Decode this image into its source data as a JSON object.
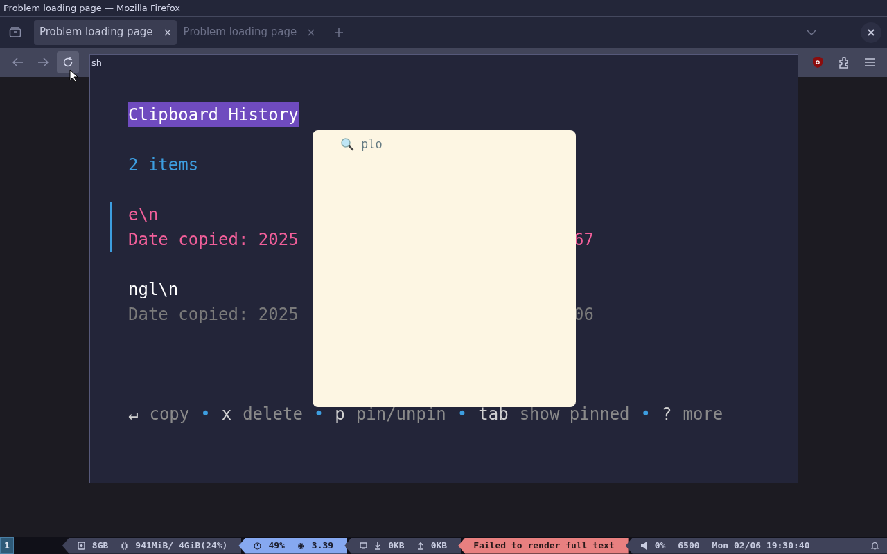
{
  "window": {
    "title": "Problem loading page — Mozilla Firefox"
  },
  "tabs": [
    {
      "label": "Problem loading page",
      "selected": true
    },
    {
      "label": "Problem loading page",
      "selected": false
    }
  ],
  "terminal": {
    "title": "sh",
    "heading": "Clipboard History",
    "count": "2 items",
    "entries": [
      {
        "text": "e\\n",
        "date_start": "Date copied: 2025",
        "date_end": "67",
        "selected": true
      },
      {
        "text": "ngl\\n",
        "date_start": "Date copied: 2025",
        "date_end": "06",
        "selected": false
      }
    ],
    "shortcuts": [
      {
        "key": "↵",
        "label": "copy"
      },
      {
        "key": "x",
        "label": "delete"
      },
      {
        "key": "p",
        "label": "pin/unpin"
      },
      {
        "key": "tab",
        "label": "show pinned"
      },
      {
        "key": "?",
        "label": "more"
      }
    ],
    "bullet": "•",
    "search": {
      "value": "plo"
    }
  },
  "status_bar": {
    "workspace": "1",
    "segments": [
      {
        "kind": "normal",
        "items": [
          "8GB",
          "941MiB/ 4GiB(24%)"
        ]
      },
      {
        "kind": "accent",
        "items": [
          "49%",
          "3.39"
        ]
      },
      {
        "kind": "normal",
        "items": [
          "0KB",
          "0KB"
        ]
      },
      {
        "kind": "error",
        "items": [
          "Failed to render full text"
        ]
      },
      {
        "kind": "normal",
        "items": [
          "0%",
          "6500",
          "Mon 02/06 19:30:40"
        ]
      }
    ]
  }
}
